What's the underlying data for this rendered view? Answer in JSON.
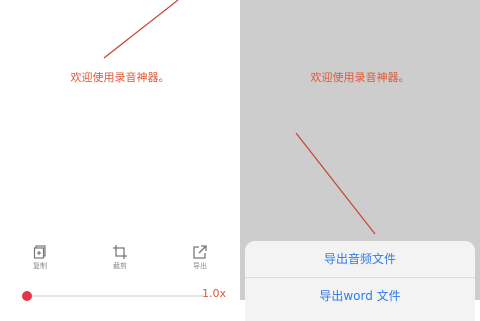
{
  "left": {
    "welcome_text": "欢迎使用录音神器。",
    "toolbar": {
      "copy_label": "复制",
      "cut_label": "截剪",
      "export_label": "导出"
    },
    "player": {
      "speed_label": "1.0x"
    }
  },
  "right": {
    "welcome_text": "欢迎使用录音神器。",
    "action_sheet": {
      "options": [
        "导出音频文件",
        "导出word 文件"
      ]
    }
  },
  "colors": {
    "accent_red": "#e0573a",
    "link_blue": "#2f7ae5",
    "dim_overlay": "#cdcdcd"
  }
}
